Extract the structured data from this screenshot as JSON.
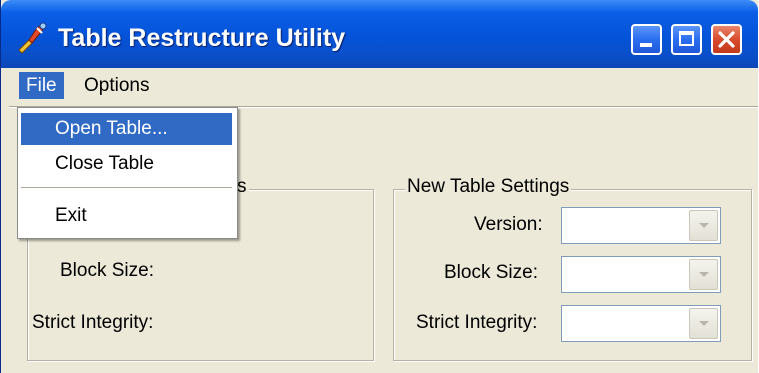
{
  "window": {
    "title": "Table Restructure Utility",
    "icon": "wrench-tool-icon",
    "controls": [
      "minimize-icon",
      "maximize-icon",
      "close-icon"
    ]
  },
  "menubar": {
    "items": [
      {
        "label": "File",
        "active": true
      },
      {
        "label": "Options",
        "active": false
      }
    ]
  },
  "file_menu": {
    "items": [
      {
        "label": "Open Table...",
        "highlighted": true
      },
      {
        "label": "Close Table",
        "highlighted": false
      },
      {
        "label": "Exit",
        "highlighted": false
      }
    ]
  },
  "current_settings": {
    "legend_visible_fragment": "s",
    "block_size_label": "Block Size:",
    "strict_integrity_label": "Strict Integrity:"
  },
  "new_settings": {
    "legend": "New Table Settings",
    "version_label": "Version:",
    "version_value": "",
    "block_size_label": "Block Size:",
    "block_size_value": "",
    "strict_integrity_label": "Strict Integrity:",
    "strict_integrity_value": ""
  },
  "colors": {
    "titlebar": "#0453d8",
    "menu_highlight": "#316ac5",
    "window_bg": "#ece9d8",
    "close_button": "#d94b2c"
  }
}
